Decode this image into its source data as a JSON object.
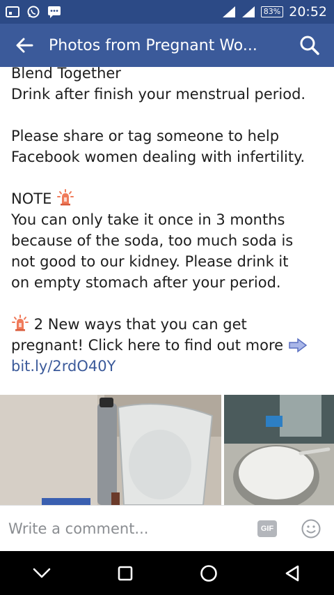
{
  "status_bar": {
    "battery": "83%",
    "time": "20:52",
    "left_icons": [
      "image-icon",
      "whatsapp-icon",
      "message-icon"
    ],
    "right_icons": [
      "signal-icon",
      "signal-icon"
    ]
  },
  "app_bar": {
    "title": "Photos from Pregnant Wo...",
    "back_icon": "arrow-left-icon",
    "search_icon": "search-icon",
    "background": "#3b5a9a"
  },
  "post": {
    "line_1": "Blend Together",
    "line_2": "Drink after finish your menstrual period.",
    "share_1": "Please share or tag someone to help",
    "share_2": "Facebook women dealing with infertility.",
    "note_title": "NOTE",
    "note_1": "You can only take it once in 3 months",
    "note_2": "because of the soda, too much soda is",
    "note_3": "not good to our kidney. Please drink it",
    "note_4": "on empty stomach after your period.",
    "promo_1": "2 New ways that you can get",
    "promo_2": "pregnant! Click here to find out more",
    "link": "bit.ly/2rdO40Y"
  },
  "photos": [
    "blender-photo",
    "milk-bowl-photo"
  ],
  "comment": {
    "placeholder": "Write a comment...",
    "gif_label": "GIF"
  },
  "nav_bar": [
    "chevron-down-icon",
    "square-icon",
    "circle-icon",
    "triangle-back-icon"
  ],
  "colors": {
    "status_bar": "#2c4a86",
    "app_bar": "#3b5a9a",
    "link": "#3b5a9a"
  }
}
